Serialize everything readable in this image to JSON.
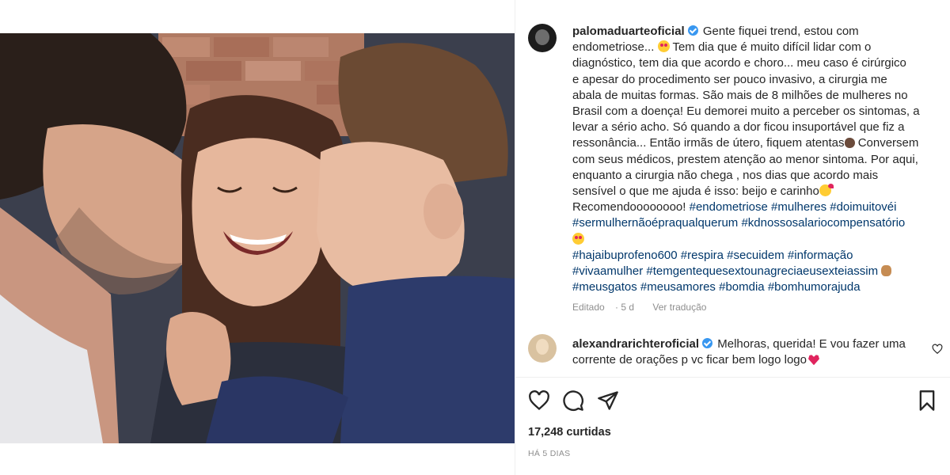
{
  "post": {
    "username": "palomaduarteoficial",
    "caption_lines": [
      [
        "Gente fiquei trend, estou com"
      ],
      [
        "endometriose... ",
        {
          "emoji": "star-struck"
        },
        "  Tem dia que é muito difícil lidar com o"
      ],
      [
        "diagnóstico, tem dia que acordo e choro... meu caso é cirúrgico"
      ],
      [
        "e apesar do procedimento ser pouco invasivo, a cirurgia me"
      ],
      [
        "abala de muitas formas. São mais de 8 milhões de mulheres no"
      ],
      [
        "Brasil com a doença! Eu demorei muito a perceber os sintomas, a"
      ],
      [
        "levar a sério acho. Só quando a dor ficou insuportável que fiz a"
      ],
      [
        "ressonância... Então irmãs de útero, fiquem atentas",
        {
          "emoji": "speaking-head"
        },
        " Conversem"
      ],
      [
        "com seus médicos, prestem atenção ao menor sintoma. Por aqui,"
      ],
      [
        "enquanto a cirurgia não chega , nos dias que acordo mais"
      ],
      [
        "sensível o que me ajuda é isso: beijo e carinho",
        {
          "emoji": "kiss-face"
        }
      ],
      [
        "Recomendoooooooo! ",
        {
          "tag": "#endometriose"
        },
        " ",
        {
          "tag": "#mulheres"
        },
        " ",
        {
          "tag": "#doimuitovéi"
        }
      ],
      [
        {
          "tag": "#sermulhernãoépraqualquerum"
        },
        " ",
        {
          "tag": "#kdnossosalariocompensatório"
        }
      ],
      [
        {
          "emoji": "star-struck"
        }
      ],
      [
        {
          "tag": "#hajaibuprofeno600"
        },
        " ",
        {
          "tag": "#respira"
        },
        " ",
        {
          "tag": "#secuidem"
        },
        " ",
        {
          "tag": "#informação"
        }
      ],
      [
        {
          "tag": "#vivaamulher"
        },
        " ",
        {
          "tag": "#temgentequesextounagreciaeusexteiassim"
        },
        " ",
        {
          "emoji": "ok-hand"
        }
      ],
      [
        {
          "tag": "#meusgatos"
        },
        " ",
        {
          "tag": "#meusamores"
        },
        " ",
        {
          "tag": "#bomdia"
        },
        " ",
        {
          "tag": "#bomhumorajuda"
        }
      ]
    ],
    "edited_label": "Editado",
    "edited_age": "5 d",
    "translate_label": "Ver tradução"
  },
  "comment": {
    "username": "alexandrarichteroficial",
    "line1": "Melhoras, querida! E vou fazer uma",
    "line2": "corrente de orações p vc ficar bem logo logo"
  },
  "actions": {
    "like_icon": "heart-outline-icon",
    "comment_icon": "comment-bubble-icon",
    "share_icon": "paper-plane-icon",
    "save_icon": "bookmark-icon"
  },
  "likes_label": "17,248 curtidas",
  "date_label": "HÁ 5 DIAS",
  "colors": {
    "verified": "#3897f0",
    "hashtag": "#00376b",
    "muted": "#8e8e8e",
    "text": "#262626"
  }
}
